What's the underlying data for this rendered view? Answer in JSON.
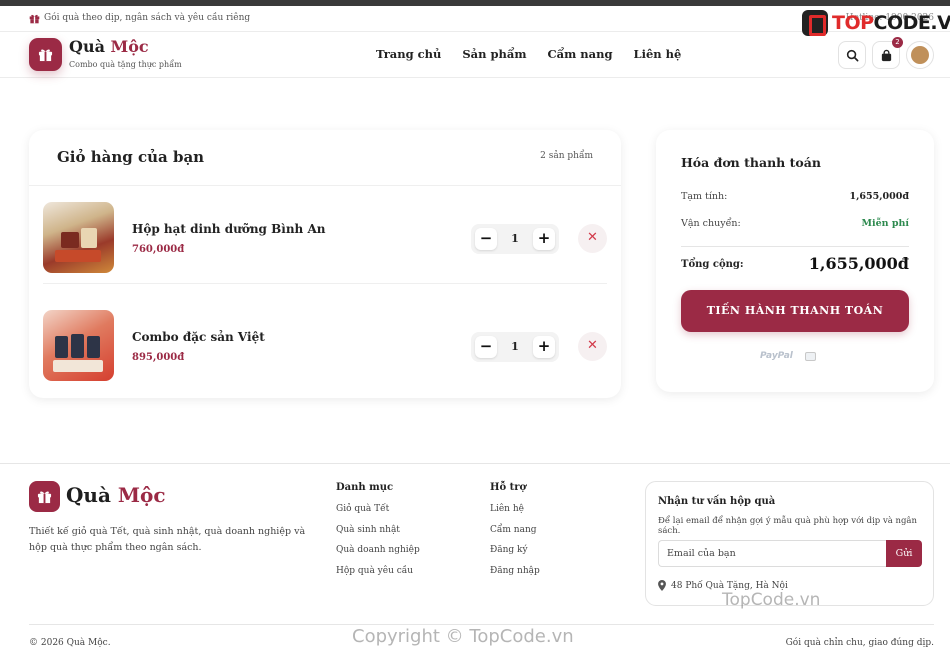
{
  "announcement": {
    "text": "Gói quà theo dịp, ngân sách và yêu cầu riêng",
    "hotline": "Hotline: 1900 2026"
  },
  "watermark": {
    "logo_left": "TOP",
    "logo_right": "CODE.VN",
    "footer_mark": "TopCode.vn",
    "copyright_mark": "Copyright © TopCode.vn"
  },
  "brand": {
    "name_first": "Quà",
    "name_second": "Mộc",
    "tagline": "Combo quà tặng thực phẩm"
  },
  "nav": {
    "items": [
      "Trang chủ",
      "Sản phẩm",
      "Cẩm nang",
      "Liên hệ"
    ]
  },
  "header_icons": {
    "search": "search-icon",
    "cart": "shopping-bag-icon",
    "cart_count": "2",
    "avatar": "avatar"
  },
  "cart": {
    "title": "Giỏ hàng của bạn",
    "count_text": "2 sản phẩm",
    "items": [
      {
        "name": "Hộp hạt dinh dưỡng Bình An",
        "price": "760,000đ",
        "qty": "1",
        "image": "gift-basket-image"
      },
      {
        "name": "Combo đặc sản Việt",
        "price": "895,000đ",
        "qty": "1",
        "image": "specialty-combo-image"
      }
    ],
    "minus": "−",
    "plus": "+",
    "remove": "✕"
  },
  "summary": {
    "title": "Hóa đơn thanh toán",
    "subtotal_label": "Tạm tính:",
    "subtotal_value": "1,655,000đ",
    "shipping_label": "Vận chuyển:",
    "shipping_value": "Miễn phí",
    "total_label": "Tổng cộng:",
    "total_value": "1,655,000đ",
    "checkout_label": "TIẾN HÀNH THANH TOÁN",
    "payment_paypal": "PayPal"
  },
  "footer": {
    "brand_first": "Quà",
    "brand_second": "Mộc",
    "description": "Thiết kế giỏ quà Tết, quà sinh nhật, quà doanh nghiệp và hộp quà thực phẩm theo ngân sách.",
    "categories": {
      "title": "Danh mục",
      "links": [
        "Giỏ quà Tết",
        "Quà sinh nhật",
        "Quà doanh nghiệp",
        "Hộp quà yêu cầu"
      ]
    },
    "support": {
      "title": "Hỗ trợ",
      "links": [
        "Liên hệ",
        "Cẩm nang",
        "Đăng ký",
        "Đăng nhập"
      ]
    },
    "newsletter": {
      "title": "Nhận tư vấn hộp quà",
      "description": "Để lại email để nhận gợi ý mẫu quà phù hợp với dịp và ngân sách.",
      "placeholder": "Email của bạn",
      "button": "Gửi",
      "address": "48 Phố Quà Tặng, Hà Nội"
    },
    "copyright": "© 2026 Quà Mộc.",
    "slogan": "Gói quà chỉn chu, giao đúng dịp."
  },
  "colors": {
    "brand": "#9b2a45",
    "free_shipping": "#2e8a4f",
    "remove": "#d23a4a"
  }
}
